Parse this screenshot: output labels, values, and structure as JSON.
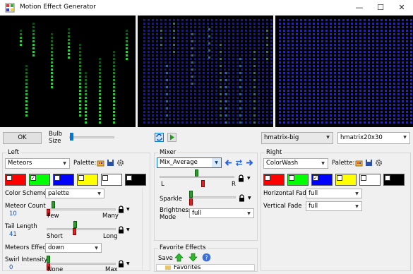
{
  "window": {
    "title": "Motion Effect Generator"
  },
  "top": {
    "ok": "OK",
    "bulb_size_label": "Bulb\nSize",
    "model_select": "hmatrix-big",
    "model_size": "hmatrix20x30"
  },
  "left": {
    "group": "Left",
    "effect": "Meteors",
    "palette_label": "Palette:",
    "colors": [
      "#ff0000",
      "#00ff00",
      "#0000ff",
      "#ffff00",
      "#ffffff",
      "#000000"
    ],
    "color_checked": [
      false,
      true,
      false,
      false,
      false,
      false
    ],
    "color_scheme_label": "Color Scheme",
    "color_scheme_value": "palette",
    "meteor_count_label": "Meteor Count",
    "meteor_count_value": "10",
    "meteor_count_min": "Few",
    "meteor_count_max": "Many",
    "meteor_count": 0.08,
    "tail_length_label": "Tail Length",
    "tail_length_value": "41",
    "tail_length_min": "Short",
    "tail_length_max": "Long",
    "tail_length": 0.41,
    "meteors_effect_label": "Meteors Effect",
    "meteors_effect_value": "down",
    "swirl_label": "Swirl Intensity",
    "swirl_value": "0",
    "swirl_min": "None",
    "swirl_max": "Max",
    "swirl": 0.0
  },
  "mixer": {
    "group": "Mixer",
    "mode": "Mix_Average",
    "slider_min": "L",
    "slider_max": "R",
    "mix": 0.5,
    "sparkle_label": "Sparkle",
    "sparkle": 0.0,
    "brightness_label": "Brightness\nMode",
    "brightness_value": "full",
    "favorites_group": "Favorite Effects",
    "save_label": "Save",
    "favorites_item": "Favorites"
  },
  "right": {
    "group": "Right",
    "effect": "ColorWash",
    "palette_label": "Palette:",
    "colors": [
      "#ff0000",
      "#00ff00",
      "#0000ff",
      "#ffff00",
      "#ffffff",
      "#000000"
    ],
    "color_checked": [
      false,
      false,
      true,
      false,
      false,
      false
    ],
    "hfade_label": "Horizontal Fade",
    "hfade_value": "full",
    "vfade_label": "Vertical Fade",
    "vfade_value": "full"
  },
  "icon_colors": {
    "preview_green": "#2ecc40",
    "preview_blue": "#1e1ef0"
  }
}
